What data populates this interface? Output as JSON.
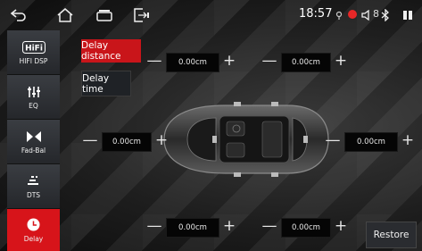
{
  "status_bar": {
    "time": "18:57",
    "bluetooth_label": "8",
    "icons": [
      "back-icon",
      "home-icon",
      "recent-apps-icon",
      "split-screen-icon",
      "location-icon",
      "record-dot-icon",
      "volume-icon",
      "bluetooth-icon",
      "battery-icon"
    ]
  },
  "sidebar": {
    "items": [
      {
        "icon": "hifi-icon",
        "label": "HIFI DSP"
      },
      {
        "icon": "equalizer-icon",
        "label": "EQ"
      },
      {
        "icon": "fader-balance-icon",
        "label": "Fad-Bal"
      },
      {
        "icon": "dts-icon",
        "label": "DTS"
      },
      {
        "icon": "clock-icon",
        "label": "Delay",
        "active": true
      }
    ]
  },
  "tabs": {
    "distance": "Delay distance",
    "time": "Delay time"
  },
  "controls": {
    "front_left": "0.00cm",
    "front_right": "0.00cm",
    "center_left": "0.00cm",
    "center_right": "0.00cm",
    "rear_left": "0.00cm",
    "rear_right": "0.00cm",
    "minus": "—",
    "plus": "+"
  },
  "restore_label": "Restore",
  "colors": {
    "accent": "#d7141a",
    "sidebar_bg": "#2e3035",
    "value_bg": "#050505"
  }
}
